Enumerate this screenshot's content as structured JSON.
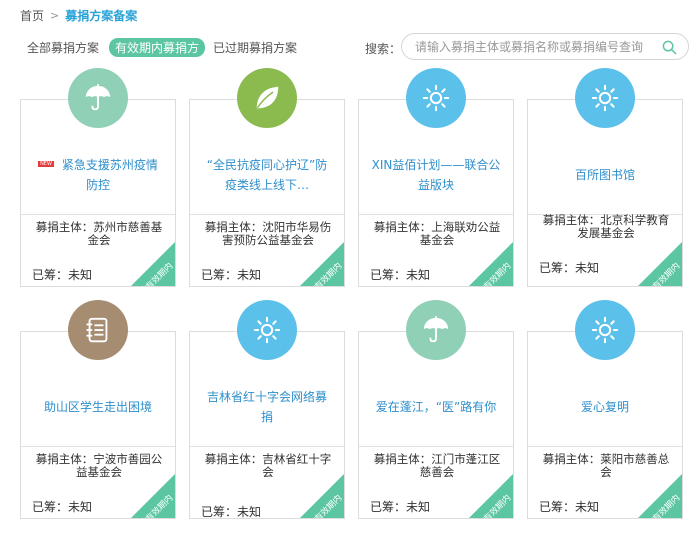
{
  "breadcrumb": {
    "home": "首页",
    "separator": ">",
    "current": "募捐方案备案"
  },
  "tabs": [
    {
      "label": "全部募捐方案",
      "active": false
    },
    {
      "label": "有效期内募捐方",
      "active": true
    },
    {
      "label": "已过期募捐方案",
      "active": false
    }
  ],
  "search": {
    "label": "搜索：",
    "placeholder": "请输入募捐主体或募捐名称或募捐编号查询",
    "value": ""
  },
  "labels": {
    "org_prefix": "募捐主体：",
    "raised_label": "已筹：",
    "ribbon": "有效期内",
    "new_badge": "NEW"
  },
  "colors": {
    "accent": "#2aa3d8",
    "tab_active": "#5cc6a3",
    "ribbon": "#5cc6a3",
    "title": "#2f8fcc"
  },
  "cards": [
    {
      "title": "紧急支援苏州疫情防控",
      "badge": true,
      "org": "募捐主体：苏州市慈善基金会",
      "raised": "已筹：未知",
      "icon": "umbrella-icon",
      "color": "#8fd0b6"
    },
    {
      "title": "“全民抗疫同心护辽”防疫类线上线下…",
      "badge": false,
      "org": "募捐主体：沈阳市华易伤害预防公益基金会",
      "raised": "已筹：未知",
      "icon": "leaf-icon",
      "color": "#8bbb4f"
    },
    {
      "title": "XIN益佰计划——联合公益版块",
      "badge": false,
      "org": "募捐主体：上海联劝公益基金会",
      "raised": "已筹：未知",
      "icon": "sun-icon",
      "color": "#5bc0ea"
    },
    {
      "title": "百所图书馆",
      "badge": false,
      "org": "募捐主体：北京科学教育发展基金会",
      "raised": "已筹：未知",
      "icon": "sun-icon",
      "color": "#5bc0ea"
    },
    {
      "title": "助山区学生走出困境",
      "badge": false,
      "org": "募捐主体：宁波市善园公益基金会",
      "raised": "已筹：未知",
      "icon": "notebook-icon",
      "color": "#a68d72"
    },
    {
      "title": "吉林省红十字会网络募捐",
      "badge": false,
      "org": "募捐主体：吉林省红十字会",
      "raised": "已筹：未知",
      "icon": "sun-icon",
      "color": "#5bc0ea"
    },
    {
      "title": "爱在蓬江，“医”路有你",
      "badge": false,
      "org": "募捐主体：江门市蓬江区慈善会",
      "raised": "已筹：未知",
      "icon": "umbrella-icon",
      "color": "#8fd0b6"
    },
    {
      "title": "爱心复明",
      "badge": false,
      "org": "募捐主体：莱阳市慈善总会",
      "raised": "已筹：未知",
      "icon": "sun-icon",
      "color": "#5bc0ea"
    }
  ]
}
